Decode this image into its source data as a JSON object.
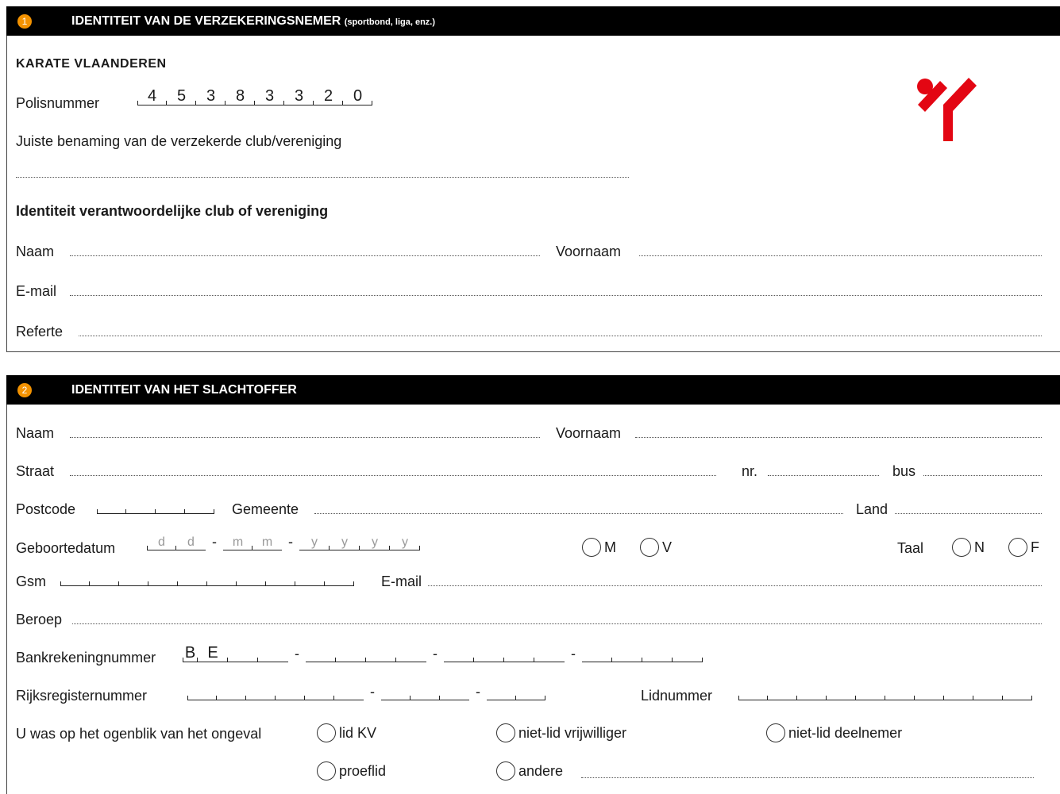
{
  "section1": {
    "number": "1",
    "title": "IDENTITEIT VAN DE VERZEKERINGSNEMER",
    "title_note": "(sportbond, liga, enz.)",
    "org_name": "KARATE VLAANDEREN",
    "policy_label": "Polisnummer",
    "policy_digits": [
      "4",
      "5",
      "3",
      "8",
      "3",
      "3",
      "2",
      "0"
    ],
    "club_name_label": "Juiste benaming van de verzekerde club/vereniging",
    "responsible_heading": "Identiteit verantwoordelijke club of vereniging",
    "naam_label": "Naam",
    "voornaam_label": "Voornaam",
    "email_label": "E-mail",
    "referte_label": "Referte"
  },
  "section2": {
    "number": "2",
    "title": "IDENTITEIT VAN HET SLACHTOFFER",
    "naam_label": "Naam",
    "voornaam_label": "Voornaam",
    "straat_label": "Straat",
    "nr_label": "nr.",
    "bus_label": "bus",
    "postcode_label": "Postcode",
    "gemeente_label": "Gemeente",
    "land_label": "Land",
    "geboortedatum_label": "Geboortedatum",
    "date_hints": [
      "d",
      "d",
      "m",
      "m",
      "y",
      "y",
      "y",
      "y"
    ],
    "gender_m": "M",
    "gender_v": "V",
    "taal_label": "Taal",
    "taal_n": "N",
    "taal_f": "F",
    "gsm_label": "Gsm",
    "email_label": "E-mail",
    "beroep_label": "Beroep",
    "bank_label": "Bankrekeningnummer",
    "bank_prefix": [
      "B",
      "E"
    ],
    "rijks_label": "Rijksregisternummer",
    "lidnummer_label": "Lidnummer",
    "status_question": "U was op het ogenblik van het ongeval",
    "options": {
      "lid_kv": "lid KV",
      "niet_lid_vrijwilliger": "niet-lid vrijwilliger",
      "niet_lid_deelnemer": "niet-lid deelnemer",
      "proeflid": "proeflid",
      "andere": "andere"
    }
  },
  "dash": "-",
  "colors": {
    "accent": "#f39200",
    "logo": "#e30613",
    "header_bg": "#000000"
  },
  "icons": {
    "logo": "karate-vlaanderen-logo"
  }
}
